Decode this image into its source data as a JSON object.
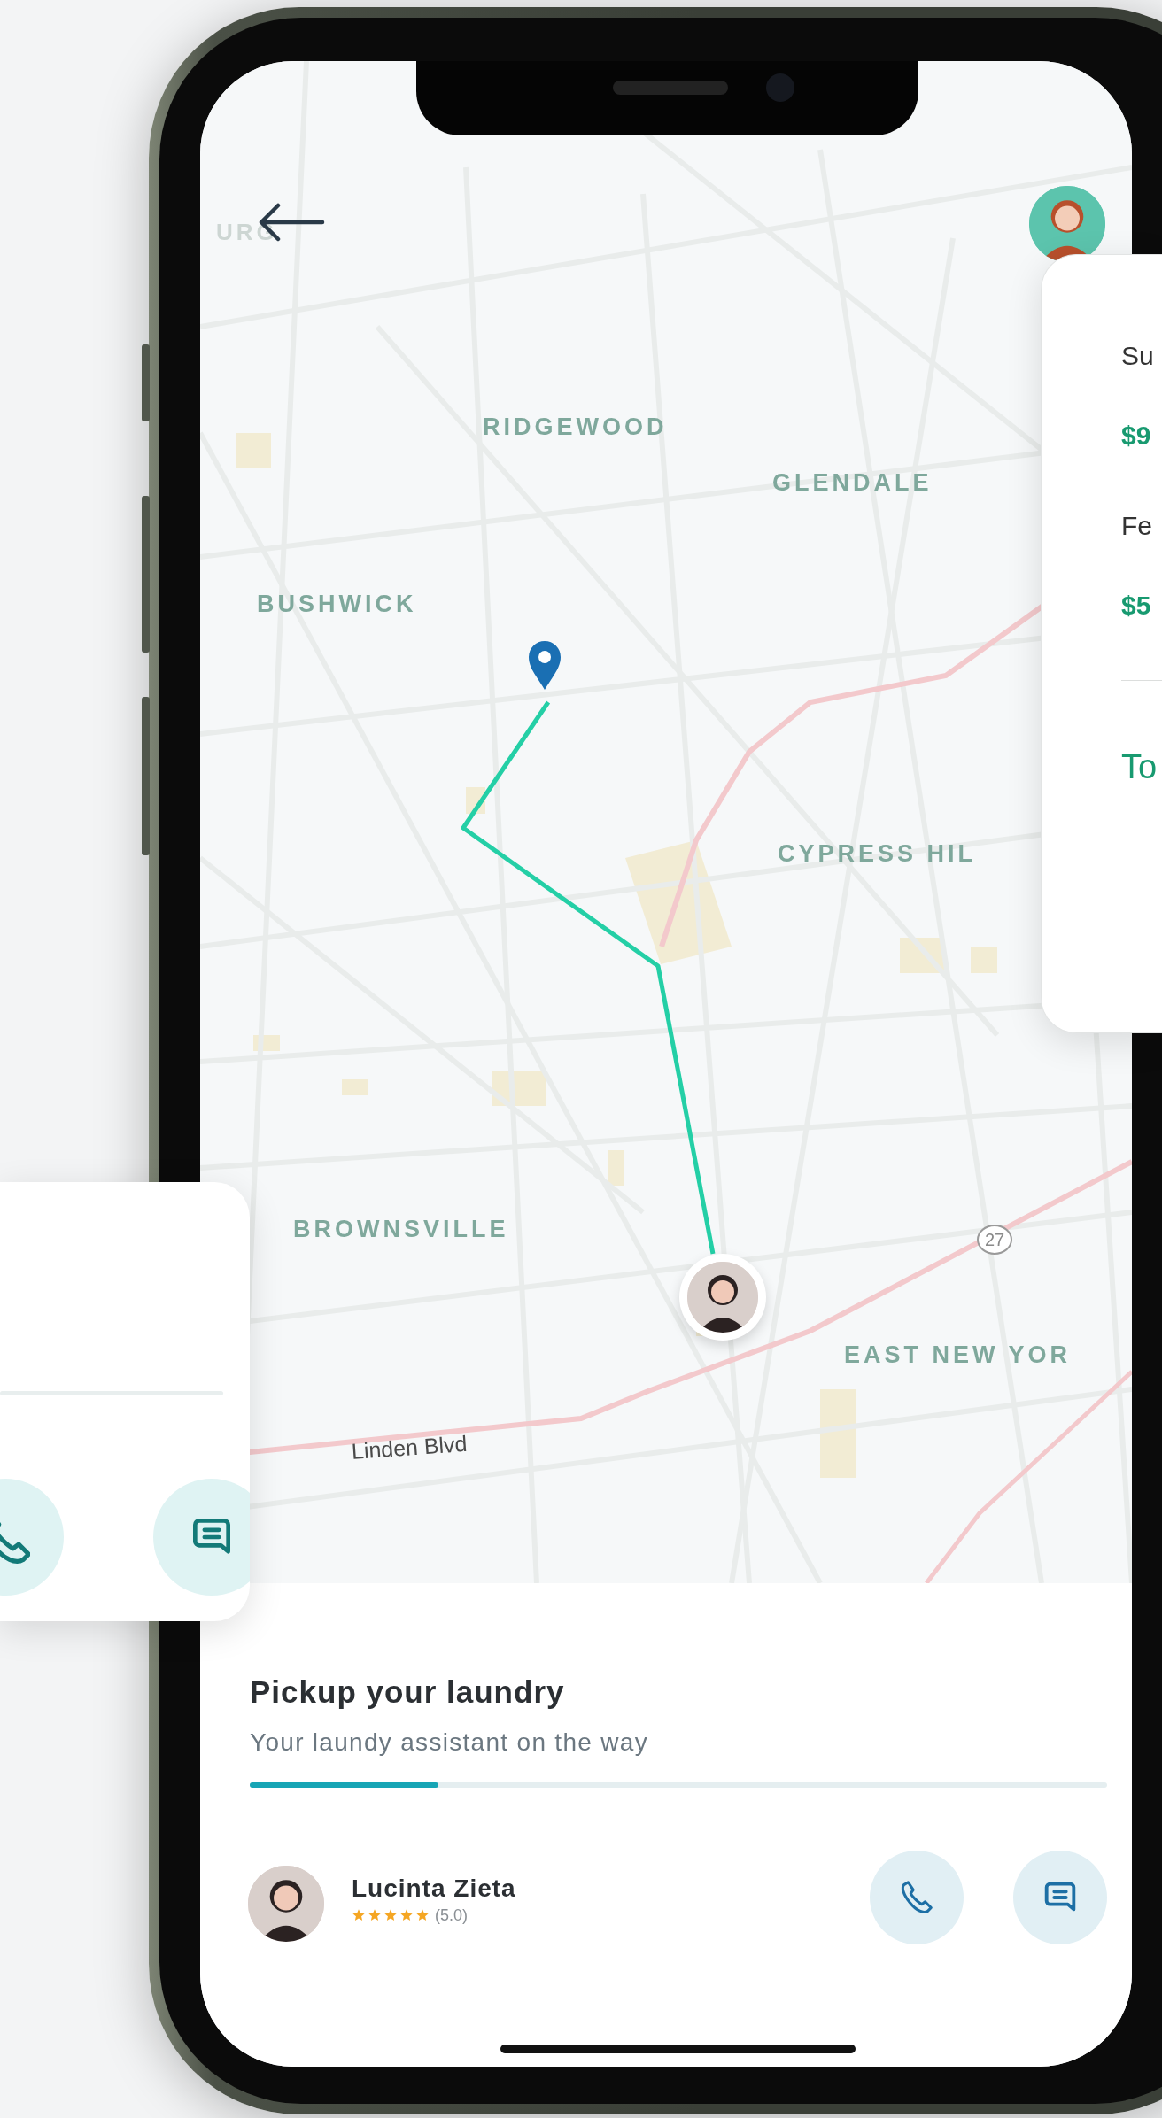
{
  "map": {
    "labels": [
      {
        "kind": "faded",
        "text": "URG"
      },
      {
        "kind": "district",
        "text": "RIDGEWOOD"
      },
      {
        "kind": "district",
        "text": "GLENDALE"
      },
      {
        "kind": "district",
        "text": "BUSHWICK"
      },
      {
        "kind": "district",
        "text": "CYPRESS HIL"
      },
      {
        "kind": "district",
        "text": "BROWNSVILLE"
      },
      {
        "kind": "shield",
        "text": "27"
      },
      {
        "kind": "district",
        "text": "EAST NEW YOR"
      },
      {
        "kind": "street",
        "text": "Linden Blvd"
      }
    ]
  },
  "summary_card": {
    "rows": [
      {
        "label": "Su",
        "amount": "$9"
      },
      {
        "label": "Fe",
        "amount": "$5"
      }
    ],
    "total_label": "To"
  },
  "sheet": {
    "title": "Pickup your laundry",
    "subtitle": "Your laundy assistant on the way",
    "progress": {
      "level": 0.22
    },
    "assistant": {
      "name": "Lucinta Zieta",
      "stars": 5,
      "rating": "(5.0)"
    }
  }
}
